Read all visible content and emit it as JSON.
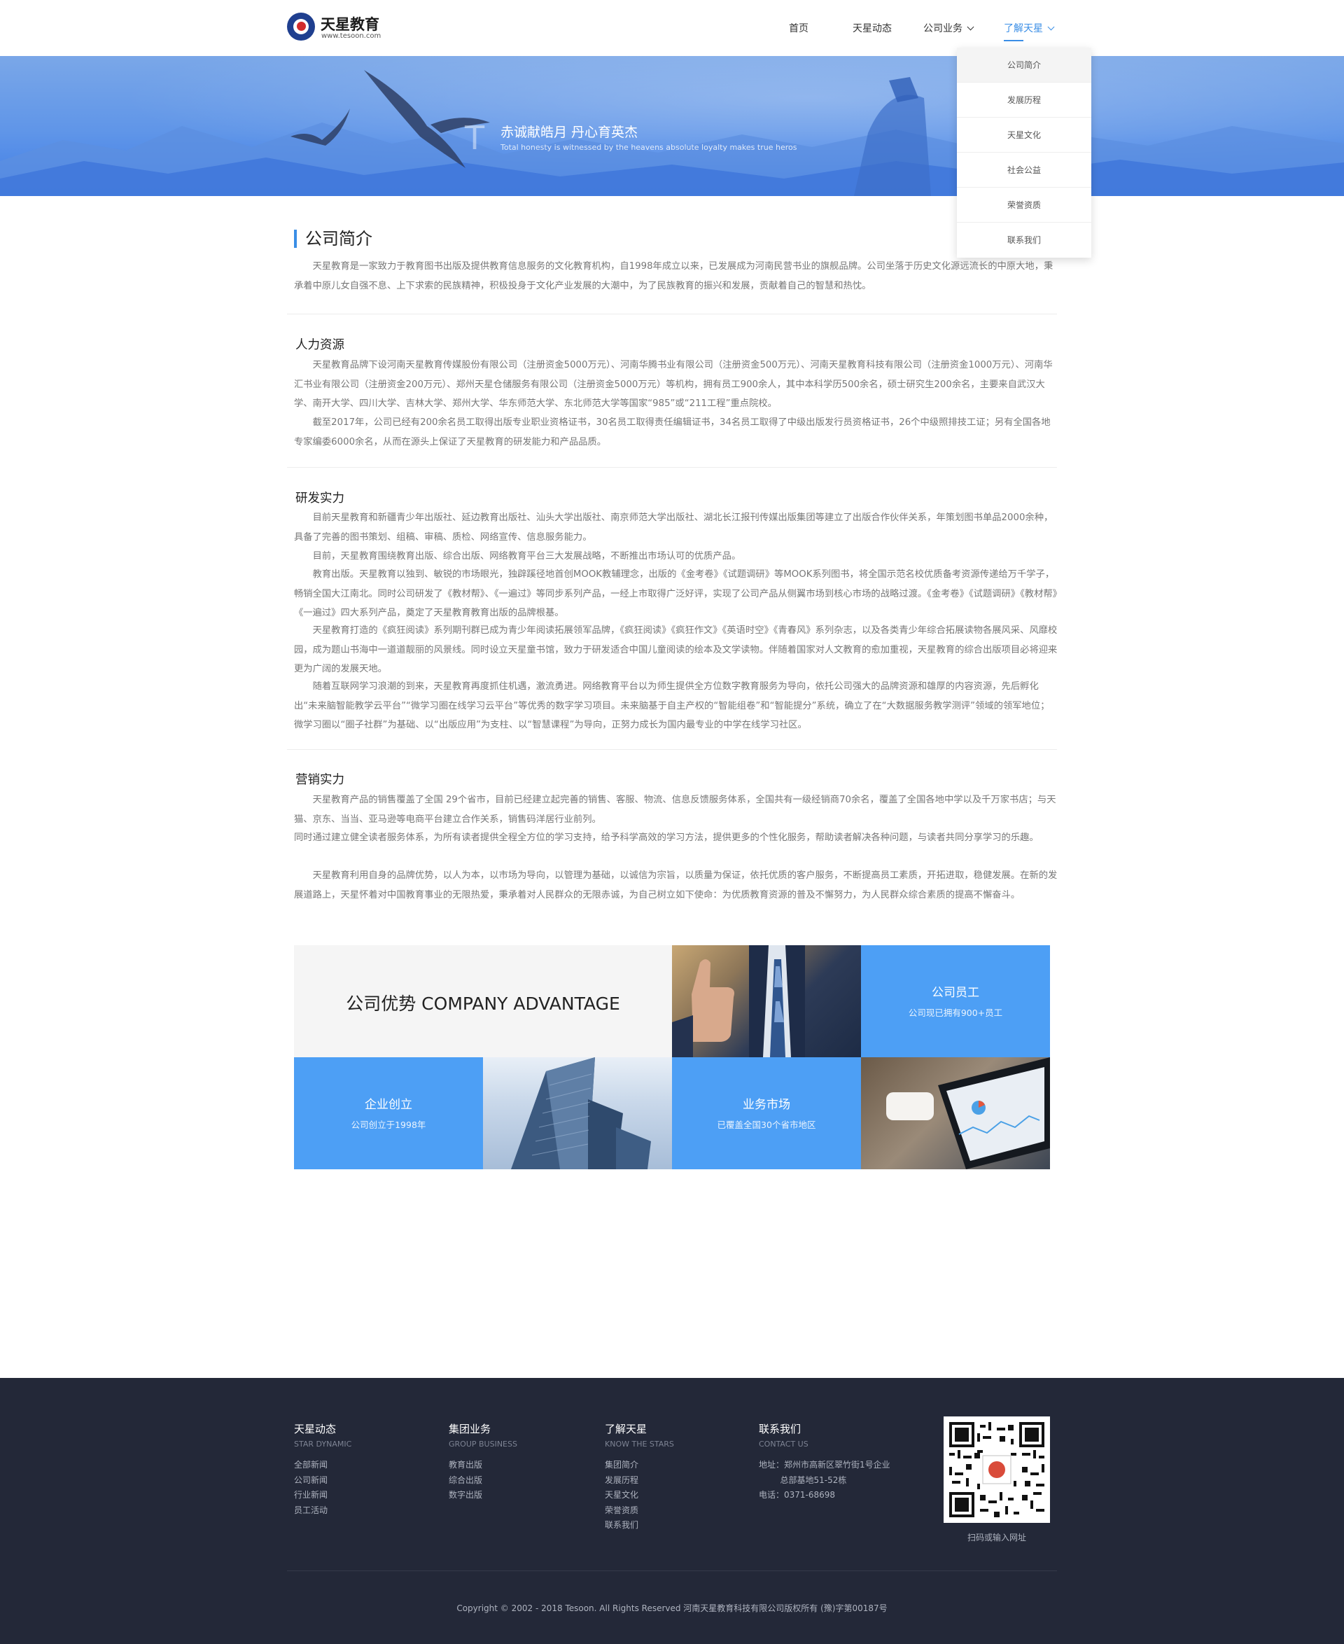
{
  "brand": {
    "name": "天星教育",
    "url": "www.tesoon.com"
  },
  "nav": {
    "items": [
      {
        "label": "首页"
      },
      {
        "label": "天星动态"
      },
      {
        "label": "公司业务"
      },
      {
        "label": "了解天星"
      }
    ],
    "active": "了解天星"
  },
  "dropdown": {
    "items": [
      "公司简介",
      "发展历程",
      "天星文化",
      "社会公益",
      "荣誉资质",
      "联系我们"
    ]
  },
  "banner": {
    "letter": "T",
    "title": "赤诚献皓月  丹心育英杰",
    "subtitle": "Total honesty is witnessed by the heavens absolute loyalty makes true heros"
  },
  "intro": {
    "title": "公司简介",
    "text": "天星教育是一家致力于教育图书出版及提供教育信息服务的文化教育机构，自1998年成立以来，已发展成为河南民营书业的旗舰品牌。公司坐落于历史文化源远流长的中原大地，秉承着中原儿女自强不息、上下求索的民族精神，积极投身于文化产业发展的大潮中，为了民族教育的振兴和发展，贡献着自己的智慧和热忱。"
  },
  "hr": {
    "title": "人力资源",
    "paragraphs": [
      "天星教育品牌下设河南天星教育传媒股份有限公司（注册资金5000万元）、河南华腾书业有限公司（注册资金500万元）、河南天星教育科技有限公司（注册资金1000万元）、河南华汇书业有限公司（注册资金200万元）、郑州天星仓储服务有限公司（注册资金5000万元）等机构，拥有员工900余人，其中本科学历500余名，硕士研究生200余名，主要来自武汉大学、南开大学、四川大学、吉林大学、郑州大学、华东师范大学、东北师范大学等国家“985”或“211工程”重点院校。",
      "截至2017年，公司已经有200余名员工取得出版专业职业资格证书，30名员工取得责任编辑证书，34名员工取得了中级出版发行员资格证书，26个中级照排技工证；另有全国各地专家编委6000余名，从而在源头上保证了天星教育的研发能力和产品品质。"
    ]
  },
  "rd": {
    "title": "研发实力",
    "paragraphs": [
      "目前天星教育和新疆青少年出版社、延边教育出版社、汕头大学出版社、南京师范大学出版社、湖北长江报刊传媒出版集团等建立了出版合作伙伴关系，年策划图书单品2000余种，具备了完善的图书策划、组稿、审稿、质检、网络宣传、信息服务能力。",
      "目前，天星教育围绕教育出版、综合出版、网络教育平台三大发展战略，不断推出市场认可的优质产品。",
      "教育出版。天星教育以独到、敏锐的市场眼光，独辟蹊径地首创MOOK教辅理念，出版的《金考卷》《试题调研》等MOOK系列图书，将全国示范名校优质备考资源传递给万千学子，畅销全国大江南北。同时公司研发了《教材帮》、《一遍过》等同步系列产品，一经上市取得广泛好评，实现了公司产品从侧翼市场到核心市场的战略过渡。《金考卷》《试题调研》《教材帮》《一遍过》四大系列产品，奠定了天星教育教育出版的品牌根基。",
      "天星教育打造的《疯狂阅读》系列期刊群已成为青少年阅读拓展领军品牌，《疯狂阅读》《疯狂作文》《英语时空》《青春风》系列杂志，以及各类青少年综合拓展读物各展风采、风靡校园，成为题山书海中一道道靓丽的风景线。同时设立天星童书馆，致力于研发适合中国儿童阅读的绘本及文学读物。伴随着国家对人文教育的愈加重视，天星教育的综合出版项目必将迎来更为广阔的发展天地。",
      "随着互联网学习浪潮的到来，天星教育再度抓住机遇，激流勇进。网络教育平台以为师生提供全方位数字教育服务为导向，依托公司强大的品牌资源和雄厚的内容资源，先后孵化出“未来脑智能教学云平台”“微学习圈在线学习云平台”等优秀的数字学习项目。未来脑基于自主产权的“智能组卷”和“智能提分”系统，确立了在“大数据服务教学测评”领域的领军地位；微学习圈以“圈子社群”为基础、以“出版应用”为支柱、以“智慧课程”为导向，正努力成长为国内最专业的中学在线学习社区。"
    ]
  },
  "marketing": {
    "title": "营销实力",
    "paragraphs": [
      {
        "text": "天星教育产品的销售覆盖了全国 29个省市，目前已经建立起完善的销售、客服、物流、信息反馈服务体系，全国共有一级经销商70余名，覆盖了全国各地中学以及千万家书店；与天猫、京东、当当、亚马逊等电商平台建立合作关系，销售码洋居行业前列。",
        "indent": true
      },
      {
        "text": "同时通过建立健全读者服务体系，为所有读者提供全程全方位的学习支持，给予科学高效的学习方法，提供更多的个性化服务，帮助读者解决各种问题，与读者共同分享学习的乐趣。",
        "indent": false
      },
      {
        "text": "天星教育利用自身的品牌优势，以人为本，以市场为导向，以管理为基础，以诚信为宗旨，以质量为保证，依托优质的客户服务，不断提高员工素质，开拓进取，稳健发展。在新的发展道路上，天星怀着对中国教育事业的无限热爱，秉承着对人民群众的无限赤诚，为自己树立如下使命：为优质教育资源的普及不懈努力，为人民群众综合素质的提高不懈奋斗。",
        "indent": true
      }
    ]
  },
  "advantage": {
    "title": "公司优势 COMPANY ADVANTAGE",
    "cells": [
      {
        "title": "公司员工",
        "sub": "公司现已拥有900+员工"
      },
      {
        "title": "企业创立",
        "sub": "公司创立于1998年"
      },
      {
        "title": "业务市场",
        "sub": "已覆盖全国30个省市地区"
      }
    ]
  },
  "footer": {
    "columns": [
      {
        "title": "天星动态",
        "sub": "STAR DYNAMIC",
        "links": [
          "全部新闻",
          "公司新闻",
          "行业新闻",
          "员工活动"
        ]
      },
      {
        "title": "集团业务",
        "sub": "GROUP BUSINESS",
        "links": [
          "教育出版",
          "综合出版",
          "数字出版"
        ]
      },
      {
        "title": "了解天星",
        "sub": "KNOW THE STARS",
        "links": [
          "集团简介",
          "发展历程",
          "天星文化",
          "荣誉资质",
          "联系我们"
        ]
      },
      {
        "title": "联系我们",
        "sub": "CONTACT US",
        "links": [
          "地址：郑州市高新区翠竹街1号企业",
          "        总部基地51-52栋",
          "电话：0371-68698"
        ]
      }
    ],
    "qr_caption": "扫码或输入网址",
    "copyright": "Copyright © 2002 - 2018 Tesoon. All Rights Reserved  河南天星教育科技有限公司版权所有 (豫)字第00187号"
  },
  "colors": {
    "accent": "#3a8ee6",
    "tile_blue": "#4d9ff5",
    "footer_bg": "#232838"
  }
}
